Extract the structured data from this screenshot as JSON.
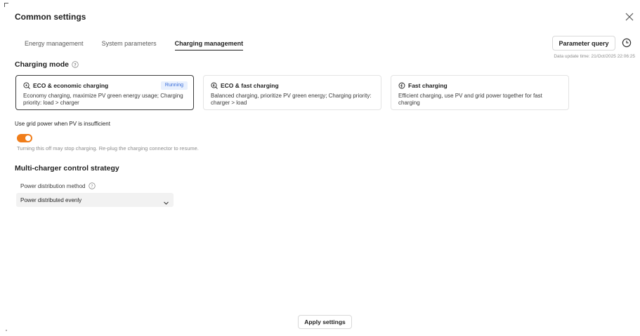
{
  "dialog": {
    "title": "Common settings"
  },
  "tabs": [
    {
      "label": "Energy management",
      "active": false
    },
    {
      "label": "System parameters",
      "active": false
    },
    {
      "label": "Charging management",
      "active": true
    }
  ],
  "toolbar": {
    "parameter_query_label": "Parameter query",
    "update_time": "Data update time: 21/Oct/2025 22:06:25"
  },
  "charging_mode": {
    "title": "Charging mode",
    "cards": [
      {
        "title": "ECO & economic charging",
        "badge": "Running",
        "description": "Economy charging, maximize PV green energy usage; Charging priority: load > charger",
        "icon": "eco-plug-icon",
        "selected": true
      },
      {
        "title": "ECO & fast charging",
        "description": "Balanced charging, prioritize PV green energy; Charging priority: charger > load",
        "icon": "eco-fast-icon",
        "selected": false
      },
      {
        "title": "Fast charging",
        "description": "Efficient charging, use PV and grid power together for fast charging",
        "icon": "fast-charge-icon",
        "selected": false
      }
    ]
  },
  "grid_power": {
    "label": "Use grid power when PV is insufficient",
    "enabled": true,
    "hint": "Turning this off may stop charging. Re-plug the charging connector to resume."
  },
  "multi_charger": {
    "title": "Multi-charger control strategy",
    "field_label": "Power distribution method",
    "selected_value": "Power distributed evenly"
  },
  "footer": {
    "apply_label": "Apply settings"
  },
  "colors": {
    "toggle_on": "#f07d1a",
    "badge_bg": "#e8f0fe",
    "badge_text": "#3b6fd8"
  }
}
